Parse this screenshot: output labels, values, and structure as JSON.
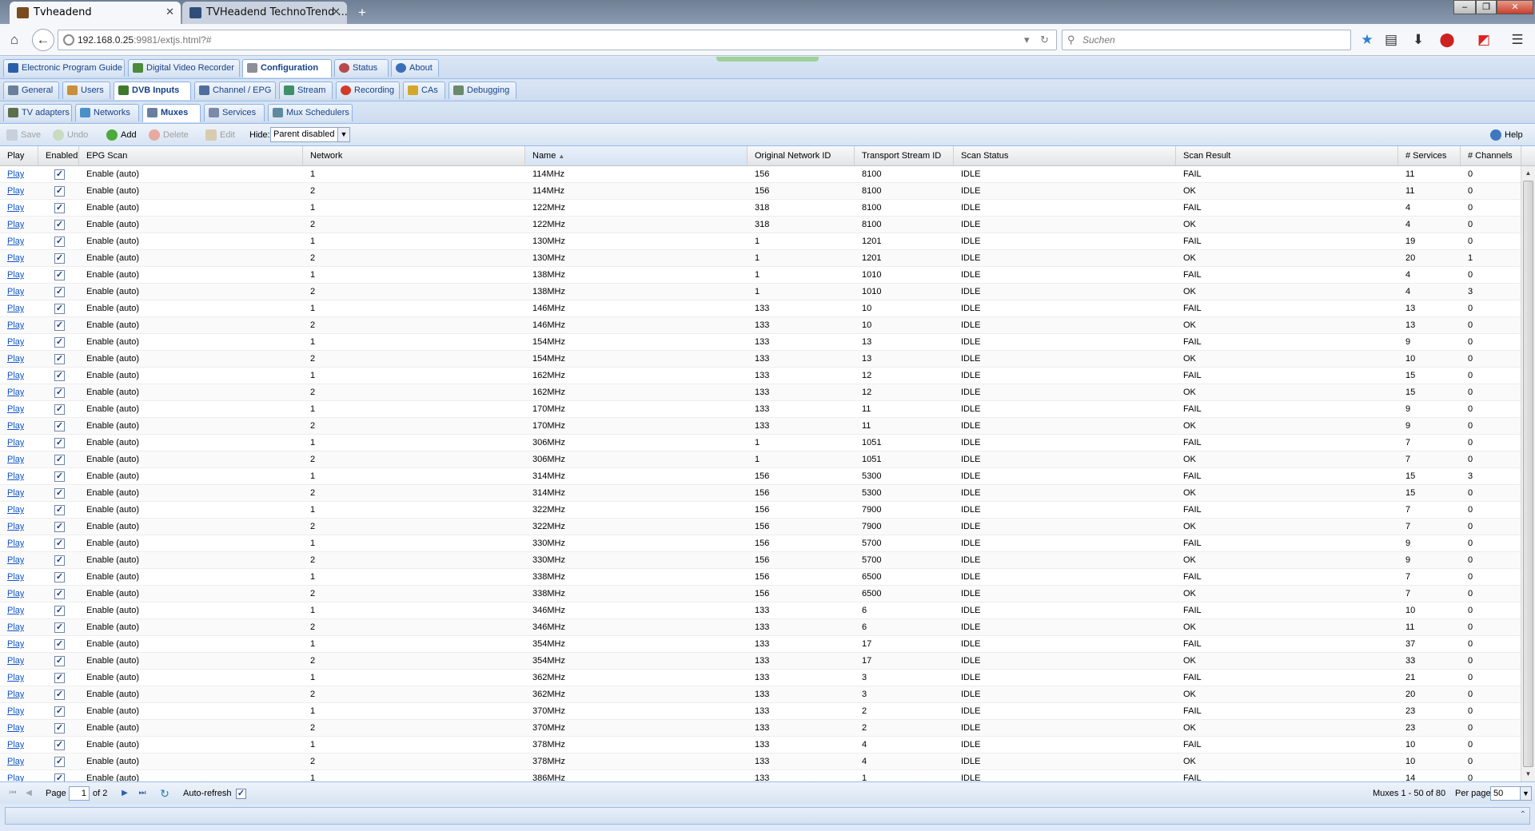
{
  "browser": {
    "tabs": [
      {
        "title": "Tvheadend",
        "active": true
      },
      {
        "title": "TVHeadend TechnoTrend ...",
        "active": false
      }
    ],
    "new_tab": "+",
    "url_host": "192.168.0.25",
    "url_rest": ":9981/extjs.html?#",
    "search_placeholder": "Suchen"
  },
  "main_tabs": [
    {
      "label": "Electronic Program Guide"
    },
    {
      "label": "Digital Video Recorder"
    },
    {
      "label": "Configuration",
      "selected": true
    },
    {
      "label": "Status"
    },
    {
      "label": "About"
    }
  ],
  "config_tabs": [
    {
      "label": "General"
    },
    {
      "label": "Users"
    },
    {
      "label": "DVB Inputs",
      "selected": true
    },
    {
      "label": "Channel / EPG"
    },
    {
      "label": "Stream"
    },
    {
      "label": "Recording"
    },
    {
      "label": "CAs"
    },
    {
      "label": "Debugging"
    }
  ],
  "dvb_tabs": [
    {
      "label": "TV adapters"
    },
    {
      "label": "Networks"
    },
    {
      "label": "Muxes",
      "selected": true
    },
    {
      "label": "Services"
    },
    {
      "label": "Mux Schedulers"
    }
  ],
  "toolbar": {
    "save": "Save",
    "undo": "Undo",
    "add": "Add",
    "delete": "Delete",
    "edit": "Edit",
    "hide_label": "Hide:",
    "hide_value": "Parent disabled",
    "help": "Help"
  },
  "columns": [
    "Play",
    "Enabled",
    "EPG Scan",
    "Network",
    "Name",
    "Original Network ID",
    "Transport Stream ID",
    "Scan Status",
    "Scan Result",
    "# Services",
    "# Channels"
  ],
  "rows": [
    [
      "Play",
      true,
      "Enable (auto)",
      "1",
      "114MHz",
      "156",
      "8100",
      "IDLE",
      "FAIL",
      "11",
      "0"
    ],
    [
      "Play",
      true,
      "Enable (auto)",
      "2",
      "114MHz",
      "156",
      "8100",
      "IDLE",
      "OK",
      "11",
      "0"
    ],
    [
      "Play",
      true,
      "Enable (auto)",
      "1",
      "122MHz",
      "318",
      "8100",
      "IDLE",
      "FAIL",
      "4",
      "0"
    ],
    [
      "Play",
      true,
      "Enable (auto)",
      "2",
      "122MHz",
      "318",
      "8100",
      "IDLE",
      "OK",
      "4",
      "0"
    ],
    [
      "Play",
      true,
      "Enable (auto)",
      "1",
      "130MHz",
      "1",
      "1201",
      "IDLE",
      "FAIL",
      "19",
      "0"
    ],
    [
      "Play",
      true,
      "Enable (auto)",
      "2",
      "130MHz",
      "1",
      "1201",
      "IDLE",
      "OK",
      "20",
      "1"
    ],
    [
      "Play",
      true,
      "Enable (auto)",
      "1",
      "138MHz",
      "1",
      "1010",
      "IDLE",
      "FAIL",
      "4",
      "0"
    ],
    [
      "Play",
      true,
      "Enable (auto)",
      "2",
      "138MHz",
      "1",
      "1010",
      "IDLE",
      "OK",
      "4",
      "3"
    ],
    [
      "Play",
      true,
      "Enable (auto)",
      "1",
      "146MHz",
      "133",
      "10",
      "IDLE",
      "FAIL",
      "13",
      "0"
    ],
    [
      "Play",
      true,
      "Enable (auto)",
      "2",
      "146MHz",
      "133",
      "10",
      "IDLE",
      "OK",
      "13",
      "0"
    ],
    [
      "Play",
      true,
      "Enable (auto)",
      "1",
      "154MHz",
      "133",
      "13",
      "IDLE",
      "FAIL",
      "9",
      "0"
    ],
    [
      "Play",
      true,
      "Enable (auto)",
      "2",
      "154MHz",
      "133",
      "13",
      "IDLE",
      "OK",
      "10",
      "0"
    ],
    [
      "Play",
      true,
      "Enable (auto)",
      "1",
      "162MHz",
      "133",
      "12",
      "IDLE",
      "FAIL",
      "15",
      "0"
    ],
    [
      "Play",
      true,
      "Enable (auto)",
      "2",
      "162MHz",
      "133",
      "12",
      "IDLE",
      "OK",
      "15",
      "0"
    ],
    [
      "Play",
      true,
      "Enable (auto)",
      "1",
      "170MHz",
      "133",
      "11",
      "IDLE",
      "FAIL",
      "9",
      "0"
    ],
    [
      "Play",
      true,
      "Enable (auto)",
      "2",
      "170MHz",
      "133",
      "11",
      "IDLE",
      "OK",
      "9",
      "0"
    ],
    [
      "Play",
      true,
      "Enable (auto)",
      "1",
      "306MHz",
      "1",
      "1051",
      "IDLE",
      "FAIL",
      "7",
      "0"
    ],
    [
      "Play",
      true,
      "Enable (auto)",
      "2",
      "306MHz",
      "1",
      "1051",
      "IDLE",
      "OK",
      "7",
      "0"
    ],
    [
      "Play",
      true,
      "Enable (auto)",
      "1",
      "314MHz",
      "156",
      "5300",
      "IDLE",
      "FAIL",
      "15",
      "3"
    ],
    [
      "Play",
      true,
      "Enable (auto)",
      "2",
      "314MHz",
      "156",
      "5300",
      "IDLE",
      "OK",
      "15",
      "0"
    ],
    [
      "Play",
      true,
      "Enable (auto)",
      "1",
      "322MHz",
      "156",
      "7900",
      "IDLE",
      "FAIL",
      "7",
      "0"
    ],
    [
      "Play",
      true,
      "Enable (auto)",
      "2",
      "322MHz",
      "156",
      "7900",
      "IDLE",
      "OK",
      "7",
      "0"
    ],
    [
      "Play",
      true,
      "Enable (auto)",
      "1",
      "330MHz",
      "156",
      "5700",
      "IDLE",
      "FAIL",
      "9",
      "0"
    ],
    [
      "Play",
      true,
      "Enable (auto)",
      "2",
      "330MHz",
      "156",
      "5700",
      "IDLE",
      "OK",
      "9",
      "0"
    ],
    [
      "Play",
      true,
      "Enable (auto)",
      "1",
      "338MHz",
      "156",
      "6500",
      "IDLE",
      "FAIL",
      "7",
      "0"
    ],
    [
      "Play",
      true,
      "Enable (auto)",
      "2",
      "338MHz",
      "156",
      "6500",
      "IDLE",
      "OK",
      "7",
      "0"
    ],
    [
      "Play",
      true,
      "Enable (auto)",
      "1",
      "346MHz",
      "133",
      "6",
      "IDLE",
      "FAIL",
      "10",
      "0"
    ],
    [
      "Play",
      true,
      "Enable (auto)",
      "2",
      "346MHz",
      "133",
      "6",
      "IDLE",
      "OK",
      "11",
      "0"
    ],
    [
      "Play",
      true,
      "Enable (auto)",
      "1",
      "354MHz",
      "133",
      "17",
      "IDLE",
      "FAIL",
      "37",
      "0"
    ],
    [
      "Play",
      true,
      "Enable (auto)",
      "2",
      "354MHz",
      "133",
      "17",
      "IDLE",
      "OK",
      "33",
      "0"
    ],
    [
      "Play",
      true,
      "Enable (auto)",
      "1",
      "362MHz",
      "133",
      "3",
      "IDLE",
      "FAIL",
      "21",
      "0"
    ],
    [
      "Play",
      true,
      "Enable (auto)",
      "2",
      "362MHz",
      "133",
      "3",
      "IDLE",
      "OK",
      "20",
      "0"
    ],
    [
      "Play",
      true,
      "Enable (auto)",
      "1",
      "370MHz",
      "133",
      "2",
      "IDLE",
      "FAIL",
      "23",
      "0"
    ],
    [
      "Play",
      true,
      "Enable (auto)",
      "2",
      "370MHz",
      "133",
      "2",
      "IDLE",
      "OK",
      "23",
      "0"
    ],
    [
      "Play",
      true,
      "Enable (auto)",
      "1",
      "378MHz",
      "133",
      "4",
      "IDLE",
      "FAIL",
      "10",
      "0"
    ],
    [
      "Play",
      true,
      "Enable (auto)",
      "2",
      "378MHz",
      "133",
      "4",
      "IDLE",
      "OK",
      "10",
      "0"
    ],
    [
      "Play",
      true,
      "Enable (auto)",
      "1",
      "386MHz",
      "133",
      "1",
      "IDLE",
      "FAIL",
      "14",
      "0"
    ]
  ],
  "pager": {
    "page_label": "Page",
    "page_value": "1",
    "of_label": "of 2",
    "auto_refresh": "Auto-refresh",
    "summary": "Muxes 1 - 50 of 80",
    "per_page_label": "Per page",
    "per_page_value": "50"
  },
  "colors": {
    "link": "#1155cc",
    "tab_text": "#15428b",
    "header_bg": "#dfe8f6"
  }
}
